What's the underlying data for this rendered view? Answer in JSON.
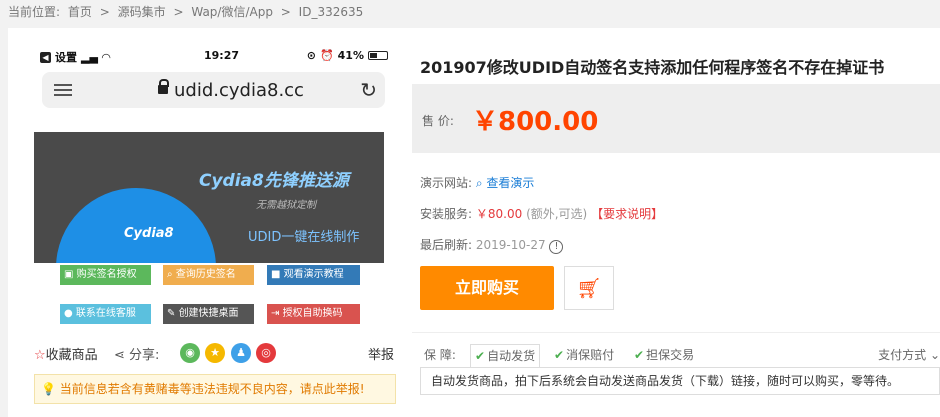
{
  "breadcrumb": {
    "label": "当前位置:",
    "items": [
      "首页",
      ">",
      "源码集市",
      ">",
      "Wap/微信/App",
      ">",
      "ID_332635"
    ]
  },
  "phone": {
    "status_left": "设置",
    "time": "19:27",
    "battery_text": "41%",
    "url": "udid.cydia8.cc"
  },
  "banner": {
    "title": "Cydia8先锋推送源",
    "subtitle": "无需越狱定制",
    "tagline": "UDID一键在线制作",
    "brand": "Cydia8"
  },
  "action_buttons": [
    {
      "label": "购买签名授权",
      "color": "#5cb85c",
      "icon": "cart-icon"
    },
    {
      "label": "查询历史签名",
      "color": "#f0ad4e",
      "icon": "search-icon"
    },
    {
      "label": "观看演示教程",
      "color": "#337ab7",
      "icon": "video-icon"
    },
    {
      "label": "联系在线客服",
      "color": "#5bc0de",
      "icon": "user-icon"
    },
    {
      "label": "创建快捷桌面",
      "color": "#555555",
      "icon": "pin-icon"
    },
    {
      "label": "授权自助换码",
      "color": "#d9534f",
      "icon": "signin-icon"
    }
  ],
  "social": {
    "favorite": "收藏商品",
    "share": "分享:",
    "report": "举报"
  },
  "warning": "当前信息若含有黄赌毒等违法违规不良内容，请点此举报!",
  "product": {
    "title": "201907修改UDID自动签名支持添加任何程序签名不存在掉证书",
    "price_label": "售   价:",
    "price": "￥800.00",
    "demo_label": "演示网站:",
    "demo_value": "查看演示",
    "install_label": "安装服务:",
    "install_price": "￥80.00",
    "install_note": "(额外,可选)",
    "install_link": "【要求说明】",
    "refresh_label": "最后刷新:",
    "refresh_date": "2019-10-27",
    "buy_button": "立即购买"
  },
  "guarantee": {
    "label": "保   障:",
    "tabs": [
      "自动发货",
      "消保赔付",
      "担保交易"
    ],
    "pay_method": "支付方式",
    "description": "自动发货商品，拍下后系统会自动发送商品发货（下载）链接，随时可以购买，零等待。"
  },
  "colors": {
    "accent": "#ff4400",
    "buy_button": "#ff8a00",
    "link": "#1a7dd6"
  }
}
